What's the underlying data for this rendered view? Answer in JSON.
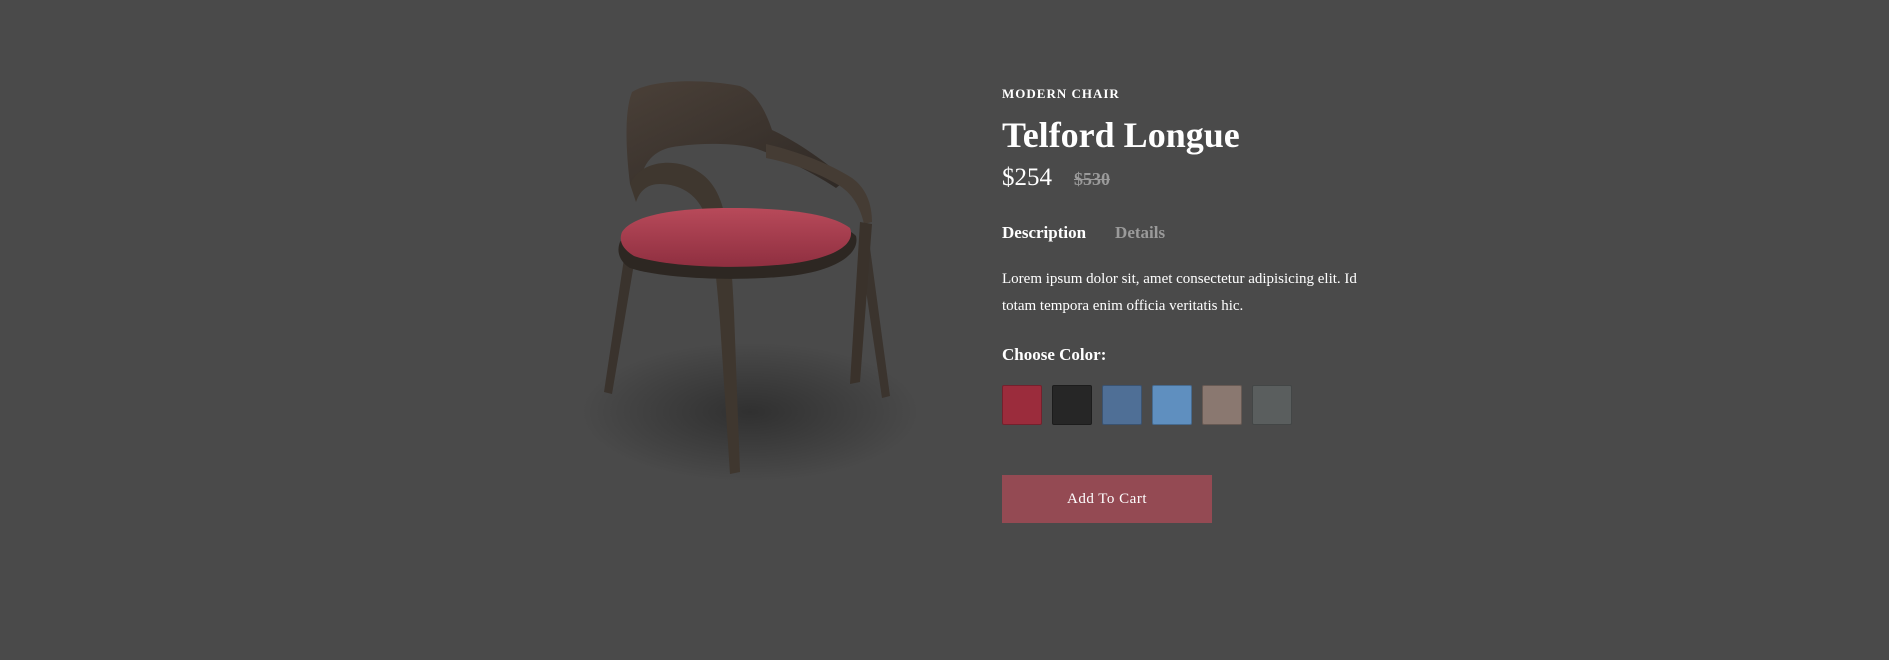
{
  "product": {
    "category": "MODERN CHAIR",
    "name": "Telford Longue",
    "price": "$254",
    "old_price": "$530",
    "image_icon": "chair-image"
  },
  "tabs": [
    {
      "label": "Description",
      "active": true
    },
    {
      "label": "Details",
      "active": false
    }
  ],
  "description": "Lorem ipsum dolor sit, amet consectetur adipisicing elit. Id totam tempora enim officia veritatis hic.",
  "color_picker": {
    "label": "Choose Color:",
    "swatches": [
      {
        "name": "red",
        "color": "#9b2c3c"
      },
      {
        "name": "black",
        "color": "#262626"
      },
      {
        "name": "blue-denim",
        "color": "#4f6f96"
      },
      {
        "name": "light-blue",
        "color": "#5f8fbf"
      },
      {
        "name": "taupe",
        "color": "#8a7870"
      },
      {
        "name": "gray",
        "color": "#5a5e5e"
      }
    ]
  },
  "cart_button": {
    "label": "Add To Cart",
    "color": "#944a53"
  },
  "colors": {
    "background": "#4a4a4a",
    "text": "#ffffff",
    "muted": "#9a9a9a"
  }
}
